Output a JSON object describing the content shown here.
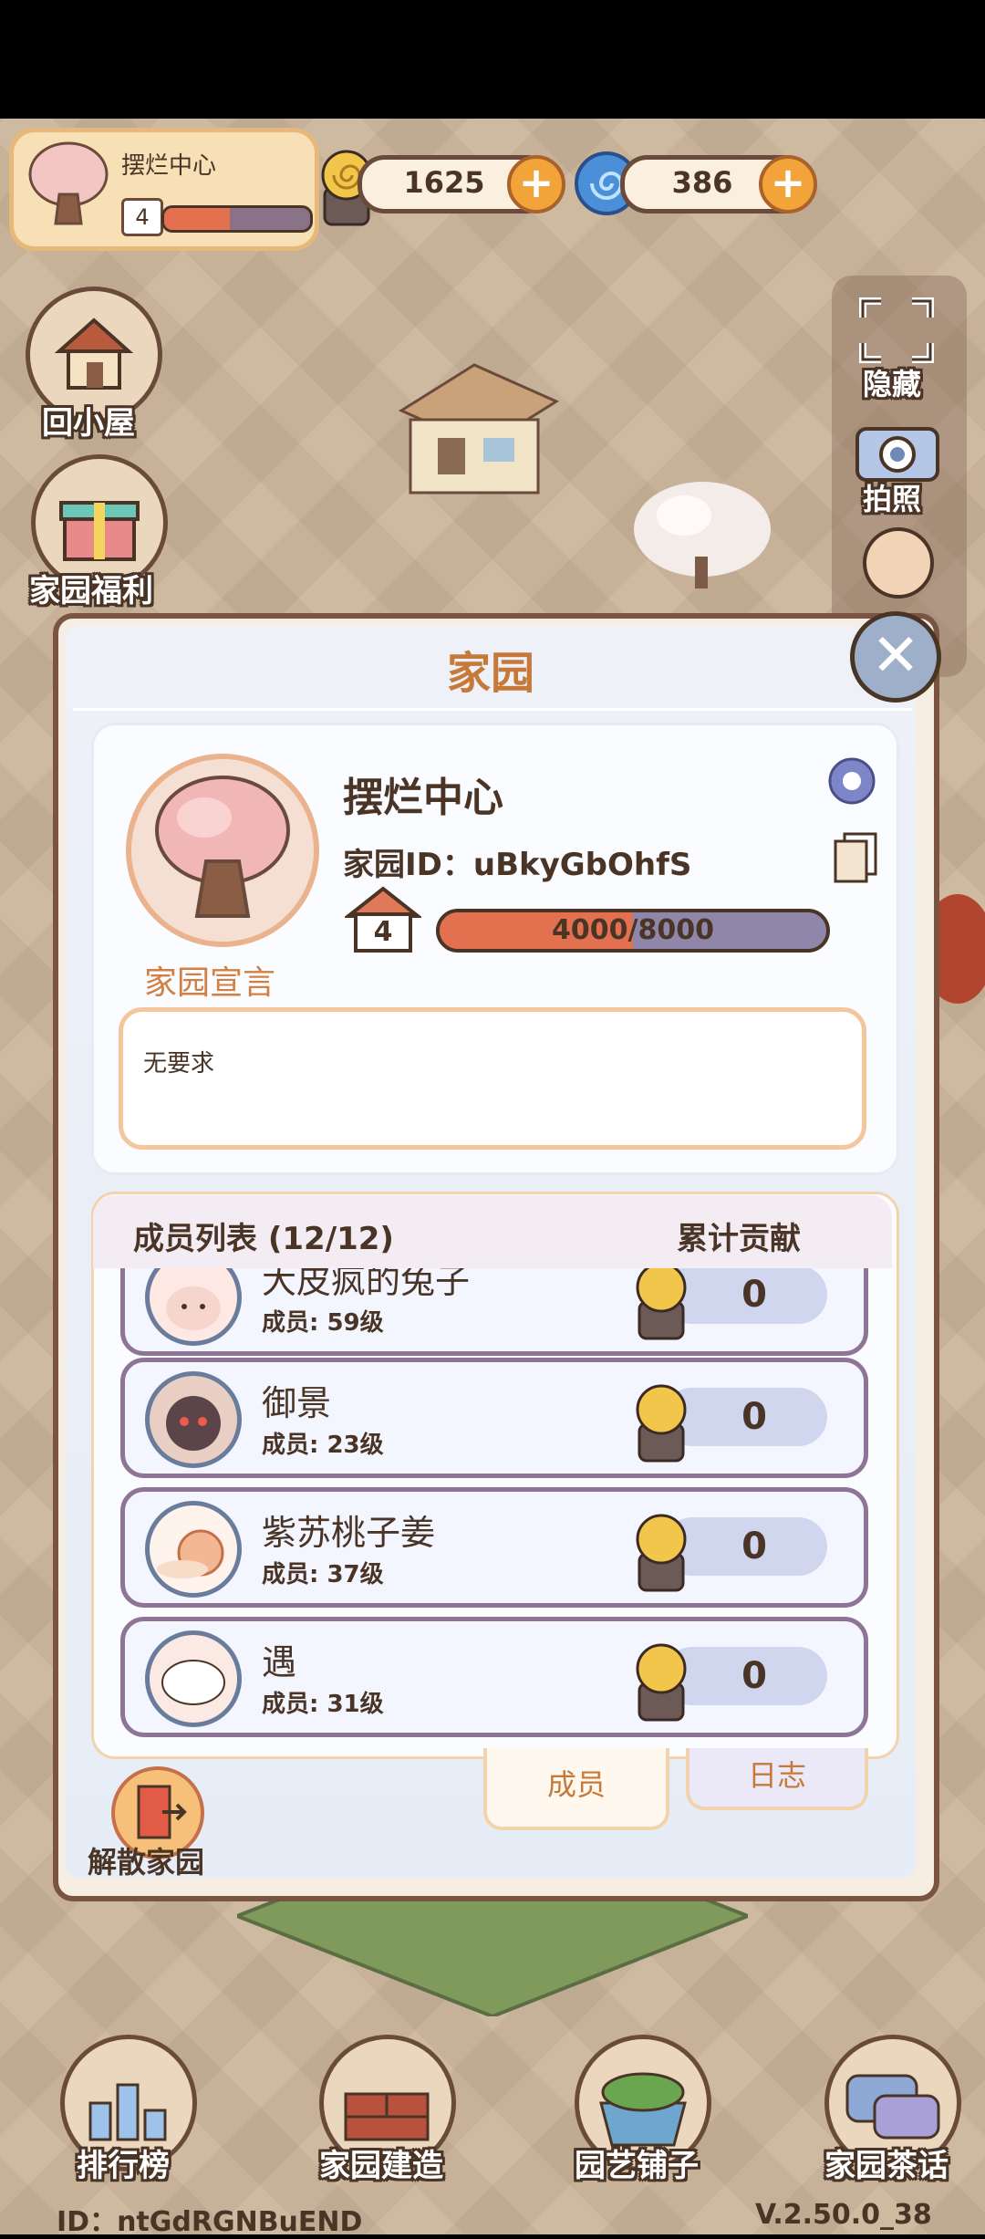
{
  "header": {
    "home_name": "摆烂中心",
    "home_level": "4",
    "home_progress": 0.45,
    "snail_coins": "1625",
    "gems": "386"
  },
  "left_menu": [
    {
      "label": "回小屋",
      "icon": "house-icon"
    },
    {
      "label": "家园福利",
      "icon": "gift-icon"
    }
  ],
  "right_menu": [
    {
      "label": "隐藏",
      "icon": "hide-icon"
    },
    {
      "label": "拍照",
      "icon": "camera-icon"
    }
  ],
  "modal": {
    "title": "家园",
    "garden_name": "摆烂中心",
    "garden_id_label": "家园ID：",
    "garden_id": "uBkyGbOhfS",
    "level": "4",
    "exp_text": "4000/8000",
    "exp_progress": 0.5,
    "declaration_label": "家园宣言",
    "declaration_text": "无要求",
    "members_header": "成员列表 (12/12)",
    "contribution_header": "累计贡献",
    "members": [
      {
        "name": "大皮疯的兔子",
        "level": "成员: 59级",
        "contribution": "0"
      },
      {
        "name": "御景",
        "level": "成员: 23级",
        "contribution": "0"
      },
      {
        "name": "紫苏桃子姜",
        "level": "成员: 37级",
        "contribution": "0"
      },
      {
        "name": "遇",
        "level": "成员: 31级",
        "contribution": "0"
      }
    ],
    "tabs": [
      "成员",
      "日志"
    ],
    "dissolve_label": "解散家园"
  },
  "bottom_nav": [
    {
      "label": "排行榜",
      "icon": "trophy-icon"
    },
    {
      "label": "家园建造",
      "icon": "bricks-icon"
    },
    {
      "label": "园艺铺子",
      "icon": "planter-icon"
    },
    {
      "label": "家园茶话",
      "icon": "chat-icon"
    }
  ],
  "footer": {
    "user_id": "ID：ntGdRGNBuEND",
    "version": "V.2.50.0_38"
  },
  "colors": {
    "accent": "#c7793a",
    "frame": "#7a5443",
    "exp_fill": "#e3704f",
    "member_border": "#8f7595"
  }
}
